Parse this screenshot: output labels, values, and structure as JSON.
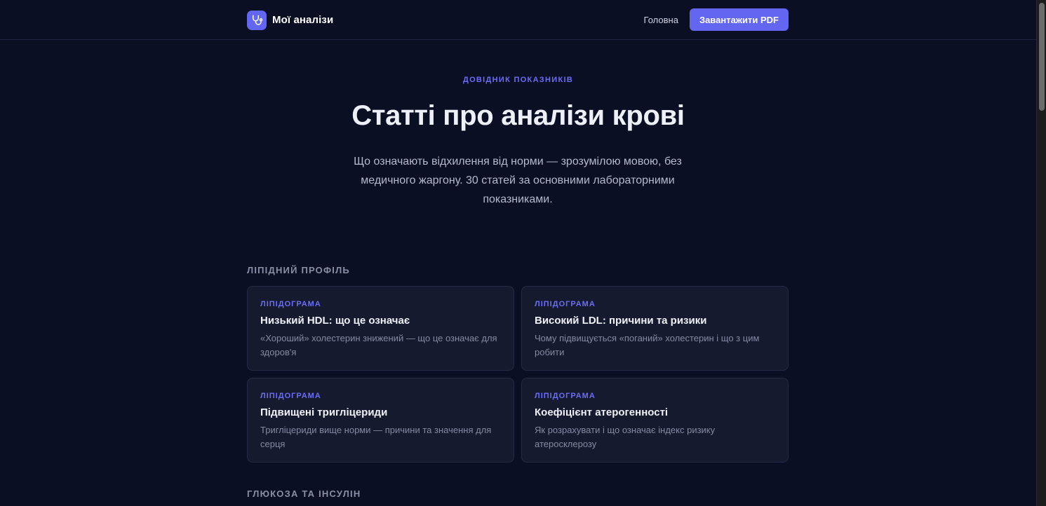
{
  "header": {
    "brand_name": "Мої аналізи",
    "nav_home": "Головна",
    "nav_button": "Завантажити PDF"
  },
  "hero": {
    "eyebrow": "ДОВІДНИК ПОКАЗНИКІВ",
    "title": "Статті про аналізи крові",
    "subtitle": "Що означають відхилення від норми — зрозумілою мовою, без медичного жаргону. 30 статей за основними лабораторними показниками."
  },
  "sections": [
    {
      "label": "ЛІПІДНИЙ ПРОФІЛЬ",
      "cards": [
        {
          "tag": "ЛІПІДОГРАМА",
          "title": "Низький HDL: що це означає",
          "desc": "«Хороший» холестерин знижений — що це означає для здоров'я"
        },
        {
          "tag": "ЛІПІДОГРАМА",
          "title": "Високий LDL: причини та ризики",
          "desc": "Чому підвищується «поганий» холестерин і що з цим робити"
        },
        {
          "tag": "ЛІПІДОГРАМА",
          "title": "Підвищені тригліцериди",
          "desc": "Тригліцериди вище норми — причини та значення для серця"
        },
        {
          "tag": "ЛІПІДОГРАМА",
          "title": "Коефіцієнт атерогенності",
          "desc": "Як розрахувати і що означає індекс ризику атеросклерозу"
        }
      ]
    },
    {
      "label": "ГЛЮКОЗА ТА ІНСУЛІН"
    }
  ],
  "colors": {
    "background": "#0b0f24",
    "accent": "#6366f1",
    "card": "#161a2f"
  }
}
